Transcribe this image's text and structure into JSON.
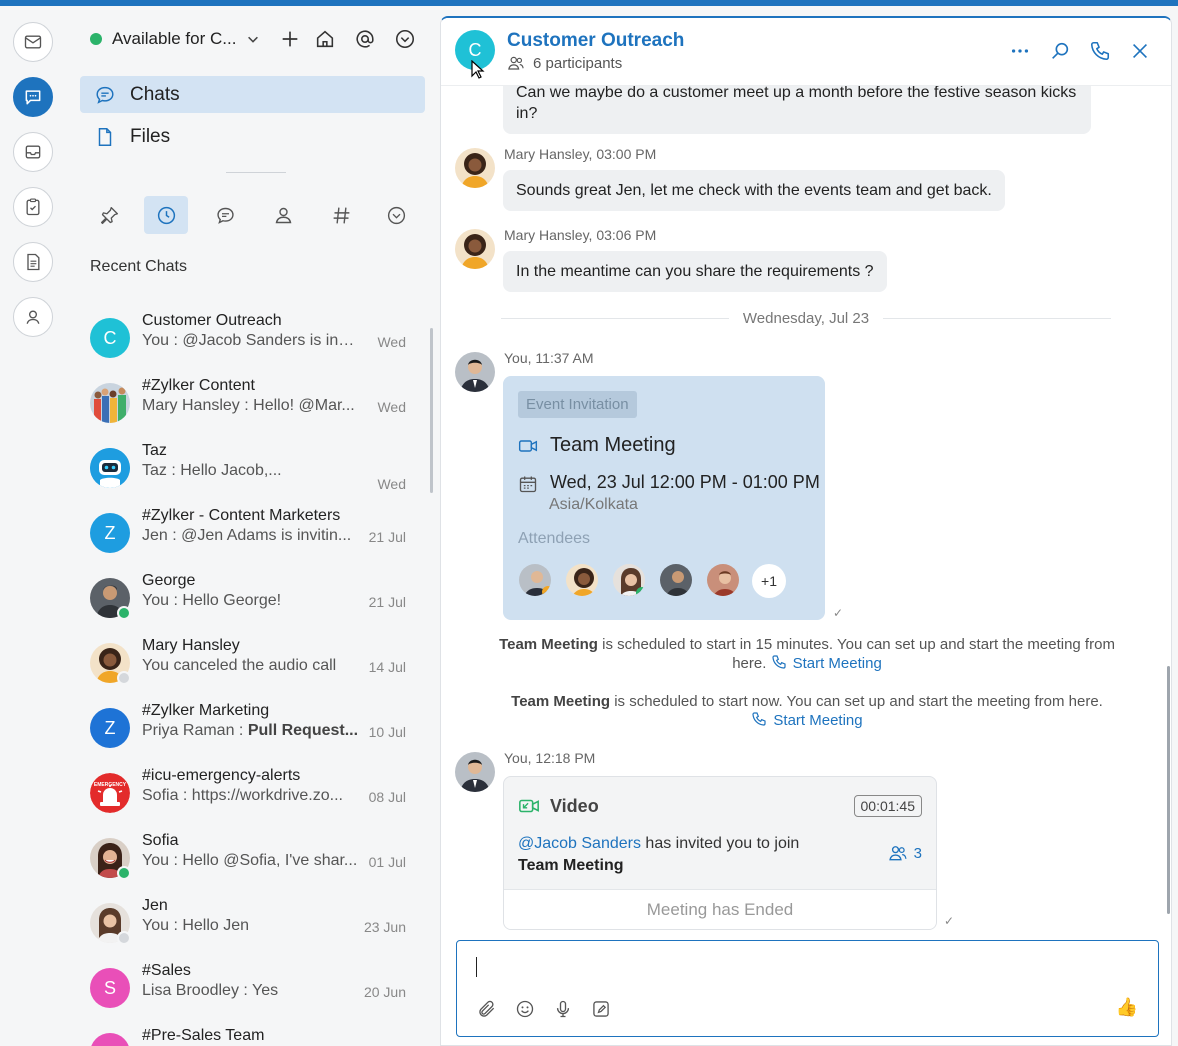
{
  "status": {
    "label": "Available for C..."
  },
  "nav": {
    "chats": "Chats",
    "files": "Files"
  },
  "recent_title": "Recent Chats",
  "chats": [
    {
      "name": "Customer Outreach",
      "preview": "You : @Jacob Sanders  is invi...",
      "time": "Wed",
      "avatar_letter": "C",
      "avatar_color": "#1fc1d6"
    },
    {
      "name": "#Zylker Content",
      "preview": "Mary Hansley : Hello!  @Mar...",
      "time": "Wed"
    },
    {
      "name": "Taz",
      "preview": "Taz : Hello Jacob,...",
      "time": "Wed"
    },
    {
      "name": "#Zylker - Content Marketers",
      "preview": "Jen : @Jen Adams  is invitin...",
      "time": "21 Jul",
      "avatar_letter": "Z",
      "avatar_color": "#1e9de0"
    },
    {
      "name": "George",
      "preview": "You : Hello George!",
      "time": "21 Jul"
    },
    {
      "name": "Mary Hansley",
      "preview": "You canceled the audio call",
      "time": "14 Jul"
    },
    {
      "name": "#Zylker Marketing",
      "preview_prefix": "Priya Raman : ",
      "preview_bold": "Pull Request...",
      "time": "10 Jul",
      "avatar_letter": "Z",
      "avatar_color": "#1e73d6"
    },
    {
      "name": "#icu-emergency-alerts",
      "preview": "Sofia : https://workdrive.zo...",
      "time": "08 Jul",
      "badge_text": "EMERGENCY"
    },
    {
      "name": "Sofia",
      "preview": "You : Hello @Sofia, I've shar...",
      "time": "01 Jul"
    },
    {
      "name": "Jen",
      "preview": "You : Hello Jen",
      "time": "23 Jun"
    },
    {
      "name": "#Sales",
      "preview": "Lisa Broodley : Yes",
      "time": "20 Jun",
      "avatar_letter": "S",
      "avatar_color": "#e94fb8"
    },
    {
      "name": "#Pre-Sales Team",
      "preview": "",
      "time": "",
      "avatar_color": "#e94fb8"
    }
  ],
  "header": {
    "avatar_letter": "C",
    "title": "Customer Outreach",
    "participants": "6 participants"
  },
  "messages": {
    "m0": "Can we maybe do a customer meet up a month before the festive season kicks in?",
    "m1_meta": "Mary  Hansley, 03:00 PM",
    "m1": "Sounds great Jen, let me check with the events team and get back.",
    "m2_meta": "Mary  Hansley, 03:06 PM",
    "m2": "In the meantime can you share the requirements ?",
    "date_sep": "Wednesday, Jul 23",
    "m3_meta": "You, 11:37 AM",
    "event": {
      "tag": "Event Invitation",
      "title": "Team Meeting",
      "when": "Wed, 23 Jul 12:00 PM - 01:00 PM",
      "tz": "Asia/Kolkata",
      "attendees_label": "Attendees",
      "more": "+1"
    },
    "sys1": {
      "bold": "Team Meeting",
      "text": " is scheduled to start in 15 minutes. You can set up and start the meeting from here.",
      "link": "Start Meeting"
    },
    "sys2": {
      "bold": "Team Meeting",
      "text": " is scheduled to start now. You can set up and start the meeting from here.",
      "link": "Start Meeting"
    },
    "m4_meta": "You, 12:18 PM",
    "video": {
      "title": "Video",
      "duration": "00:01:45",
      "mention": "@Jacob Sanders",
      "invite_text": " has invited you to join",
      "meeting": "Team Meeting",
      "count": "3",
      "ended": "Meeting has Ended"
    }
  },
  "colors": {
    "brand": "#1e73be",
    "online": "#2bb36a",
    "selected_bg": "#d3e3f3",
    "event_card": "#cfe0f0"
  },
  "icons": [
    "mail-icon",
    "chat-icon",
    "inbox-icon",
    "clipboard-icon",
    "document-icon",
    "contact-icon",
    "plus-icon",
    "home-icon",
    "at-icon",
    "chevron-circle-icon",
    "pin-icon",
    "clock-icon",
    "speech-bubble-icon",
    "person-icon",
    "hash-icon",
    "more-icon",
    "search-icon",
    "phone-icon",
    "close-icon",
    "attach-icon",
    "emoji-icon",
    "mic-icon",
    "edit-icon",
    "thumbs-up-icon"
  ]
}
